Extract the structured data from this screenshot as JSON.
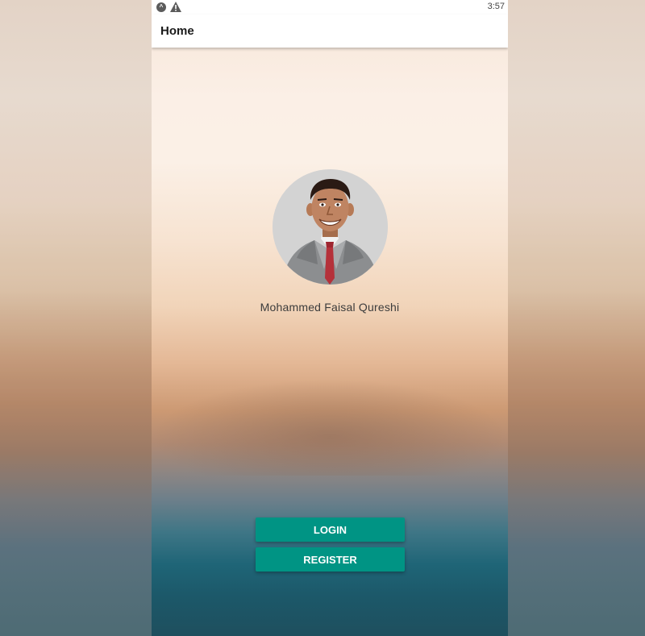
{
  "status_bar": {
    "icons": [
      "app-notification-icon",
      "warning-icon"
    ],
    "time": "3:57"
  },
  "app_bar": {
    "title": "Home"
  },
  "profile": {
    "avatar_icon": "person-caricature-avatar",
    "name": "Mohammed Faisal Qureshi"
  },
  "actions": {
    "login_label": "LOGIN",
    "register_label": "REGISTER"
  },
  "colors": {
    "button": "#009484",
    "app_bar": "#ffffff"
  }
}
